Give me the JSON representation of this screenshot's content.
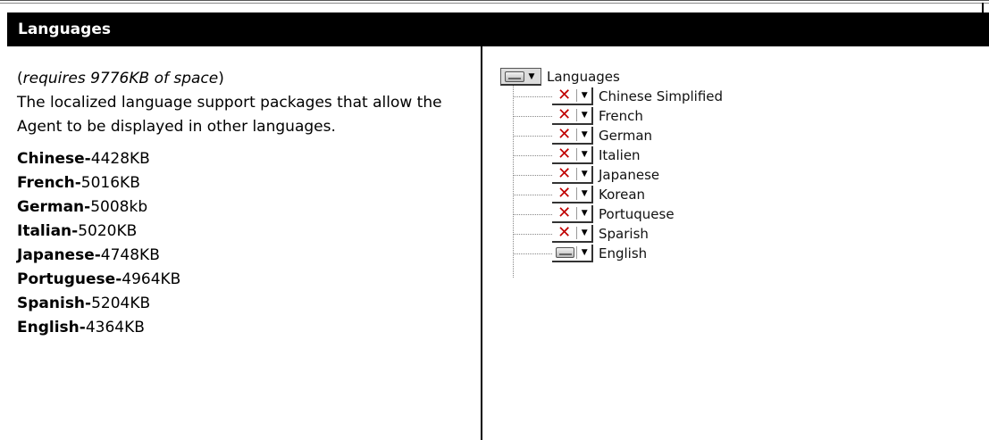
{
  "header": {
    "title": "Languages"
  },
  "left": {
    "requirement_prefix": "(",
    "requirement_text": "requires 9776KB of space",
    "requirement_suffix": ")",
    "description": "The localized language support packages that allow the Agent to be displayed in other languages.",
    "sizes": [
      {
        "name": "Chinese-",
        "size": "4428KB"
      },
      {
        "name": "French-",
        "size": "5016KB"
      },
      {
        "name": "German-",
        "size": "5008kb"
      },
      {
        "name": "Italian-",
        "size": "5020KB"
      },
      {
        "name": "Japanese-",
        "size": "4748KB"
      },
      {
        "name": "Portuguese-",
        "size": "4964KB"
      },
      {
        "name": "Spanish-",
        "size": "5204KB"
      },
      {
        "name": "English-",
        "size": "4364KB"
      }
    ]
  },
  "tree": {
    "root_label": "Languages",
    "items": [
      {
        "label": "Chinese Simplified",
        "icon": "x-icon"
      },
      {
        "label": "French",
        "icon": "x-icon"
      },
      {
        "label": "German",
        "icon": "x-icon"
      },
      {
        "label": "Italien",
        "icon": "x-icon"
      },
      {
        "label": "Japanese",
        "icon": "x-icon"
      },
      {
        "label": "Korean",
        "icon": "x-icon"
      },
      {
        "label": "Portuquese",
        "icon": "x-icon"
      },
      {
        "label": "Sparish",
        "icon": "x-icon"
      },
      {
        "label": "English",
        "icon": "drive-icon"
      }
    ],
    "x_glyph": "✕",
    "arrow_glyph": "▼",
    "colors": {
      "x": "#c00000",
      "header_bg": "#000000",
      "header_fg": "#ffffff"
    }
  }
}
